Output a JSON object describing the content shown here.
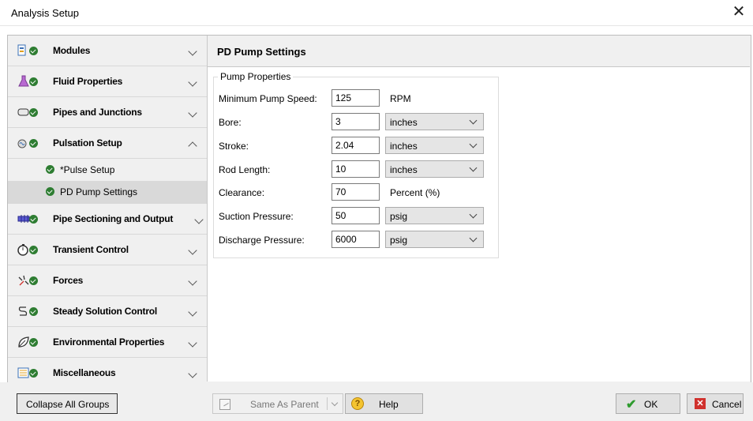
{
  "window": {
    "title": "Analysis Setup",
    "close_symbol": "✕"
  },
  "sidebar": {
    "groups": [
      {
        "label": "Modules",
        "icon": "modules-icon",
        "expanded": false
      },
      {
        "label": "Fluid Properties",
        "icon": "flask-icon",
        "expanded": false
      },
      {
        "label": "Pipes and Junctions",
        "icon": "pipe-icon",
        "expanded": false
      },
      {
        "label": "Pulsation Setup",
        "icon": "pulsation-icon",
        "expanded": true,
        "items": [
          {
            "label": "*Pulse Setup"
          },
          {
            "label": "PD Pump Settings",
            "selected": true
          }
        ]
      },
      {
        "label": "Pipe Sectioning and Output",
        "icon": "sectioning-icon",
        "expanded": false
      },
      {
        "label": "Transient Control",
        "icon": "stopwatch-icon",
        "expanded": false
      },
      {
        "label": "Forces",
        "icon": "forces-icon",
        "expanded": false
      },
      {
        "label": "Steady Solution Control",
        "icon": "solution-control-icon",
        "expanded": false
      },
      {
        "label": "Environmental Properties",
        "icon": "environment-icon",
        "expanded": false
      },
      {
        "label": "Miscellaneous",
        "icon": "miscellaneous-icon",
        "expanded": false
      }
    ]
  },
  "content": {
    "title": "PD Pump Settings",
    "groupbox_label": "Pump Properties",
    "fields": [
      {
        "label": "Minimum Pump Speed:",
        "value": "125",
        "unit": "RPM",
        "unit_is_dropdown": false
      },
      {
        "label": "Bore:",
        "value": "3",
        "unit": "inches",
        "unit_is_dropdown": true
      },
      {
        "label": "Stroke:",
        "value": "2.04",
        "unit": "inches",
        "unit_is_dropdown": true
      },
      {
        "label": "Rod Length:",
        "value": "10",
        "unit": "inches",
        "unit_is_dropdown": true
      },
      {
        "label": "Clearance:",
        "value": "70",
        "unit": "Percent (%)",
        "unit_is_dropdown": false
      },
      {
        "label": "Suction Pressure:",
        "value": "50",
        "unit": "psig",
        "unit_is_dropdown": true
      },
      {
        "label": "Discharge Pressure:",
        "value": "6000",
        "unit": "psig",
        "unit_is_dropdown": true
      }
    ]
  },
  "footer": {
    "collapse_label": "Collapse All Groups",
    "same_as_parent_label": "Same As Parent",
    "help_label": "Help",
    "ok_label": "OK",
    "cancel_label": "Cancel"
  },
  "colors": {
    "check_green": "#2e7d32",
    "cancel_red": "#d0312d",
    "selected_item_bg": "#d9d9d9"
  }
}
